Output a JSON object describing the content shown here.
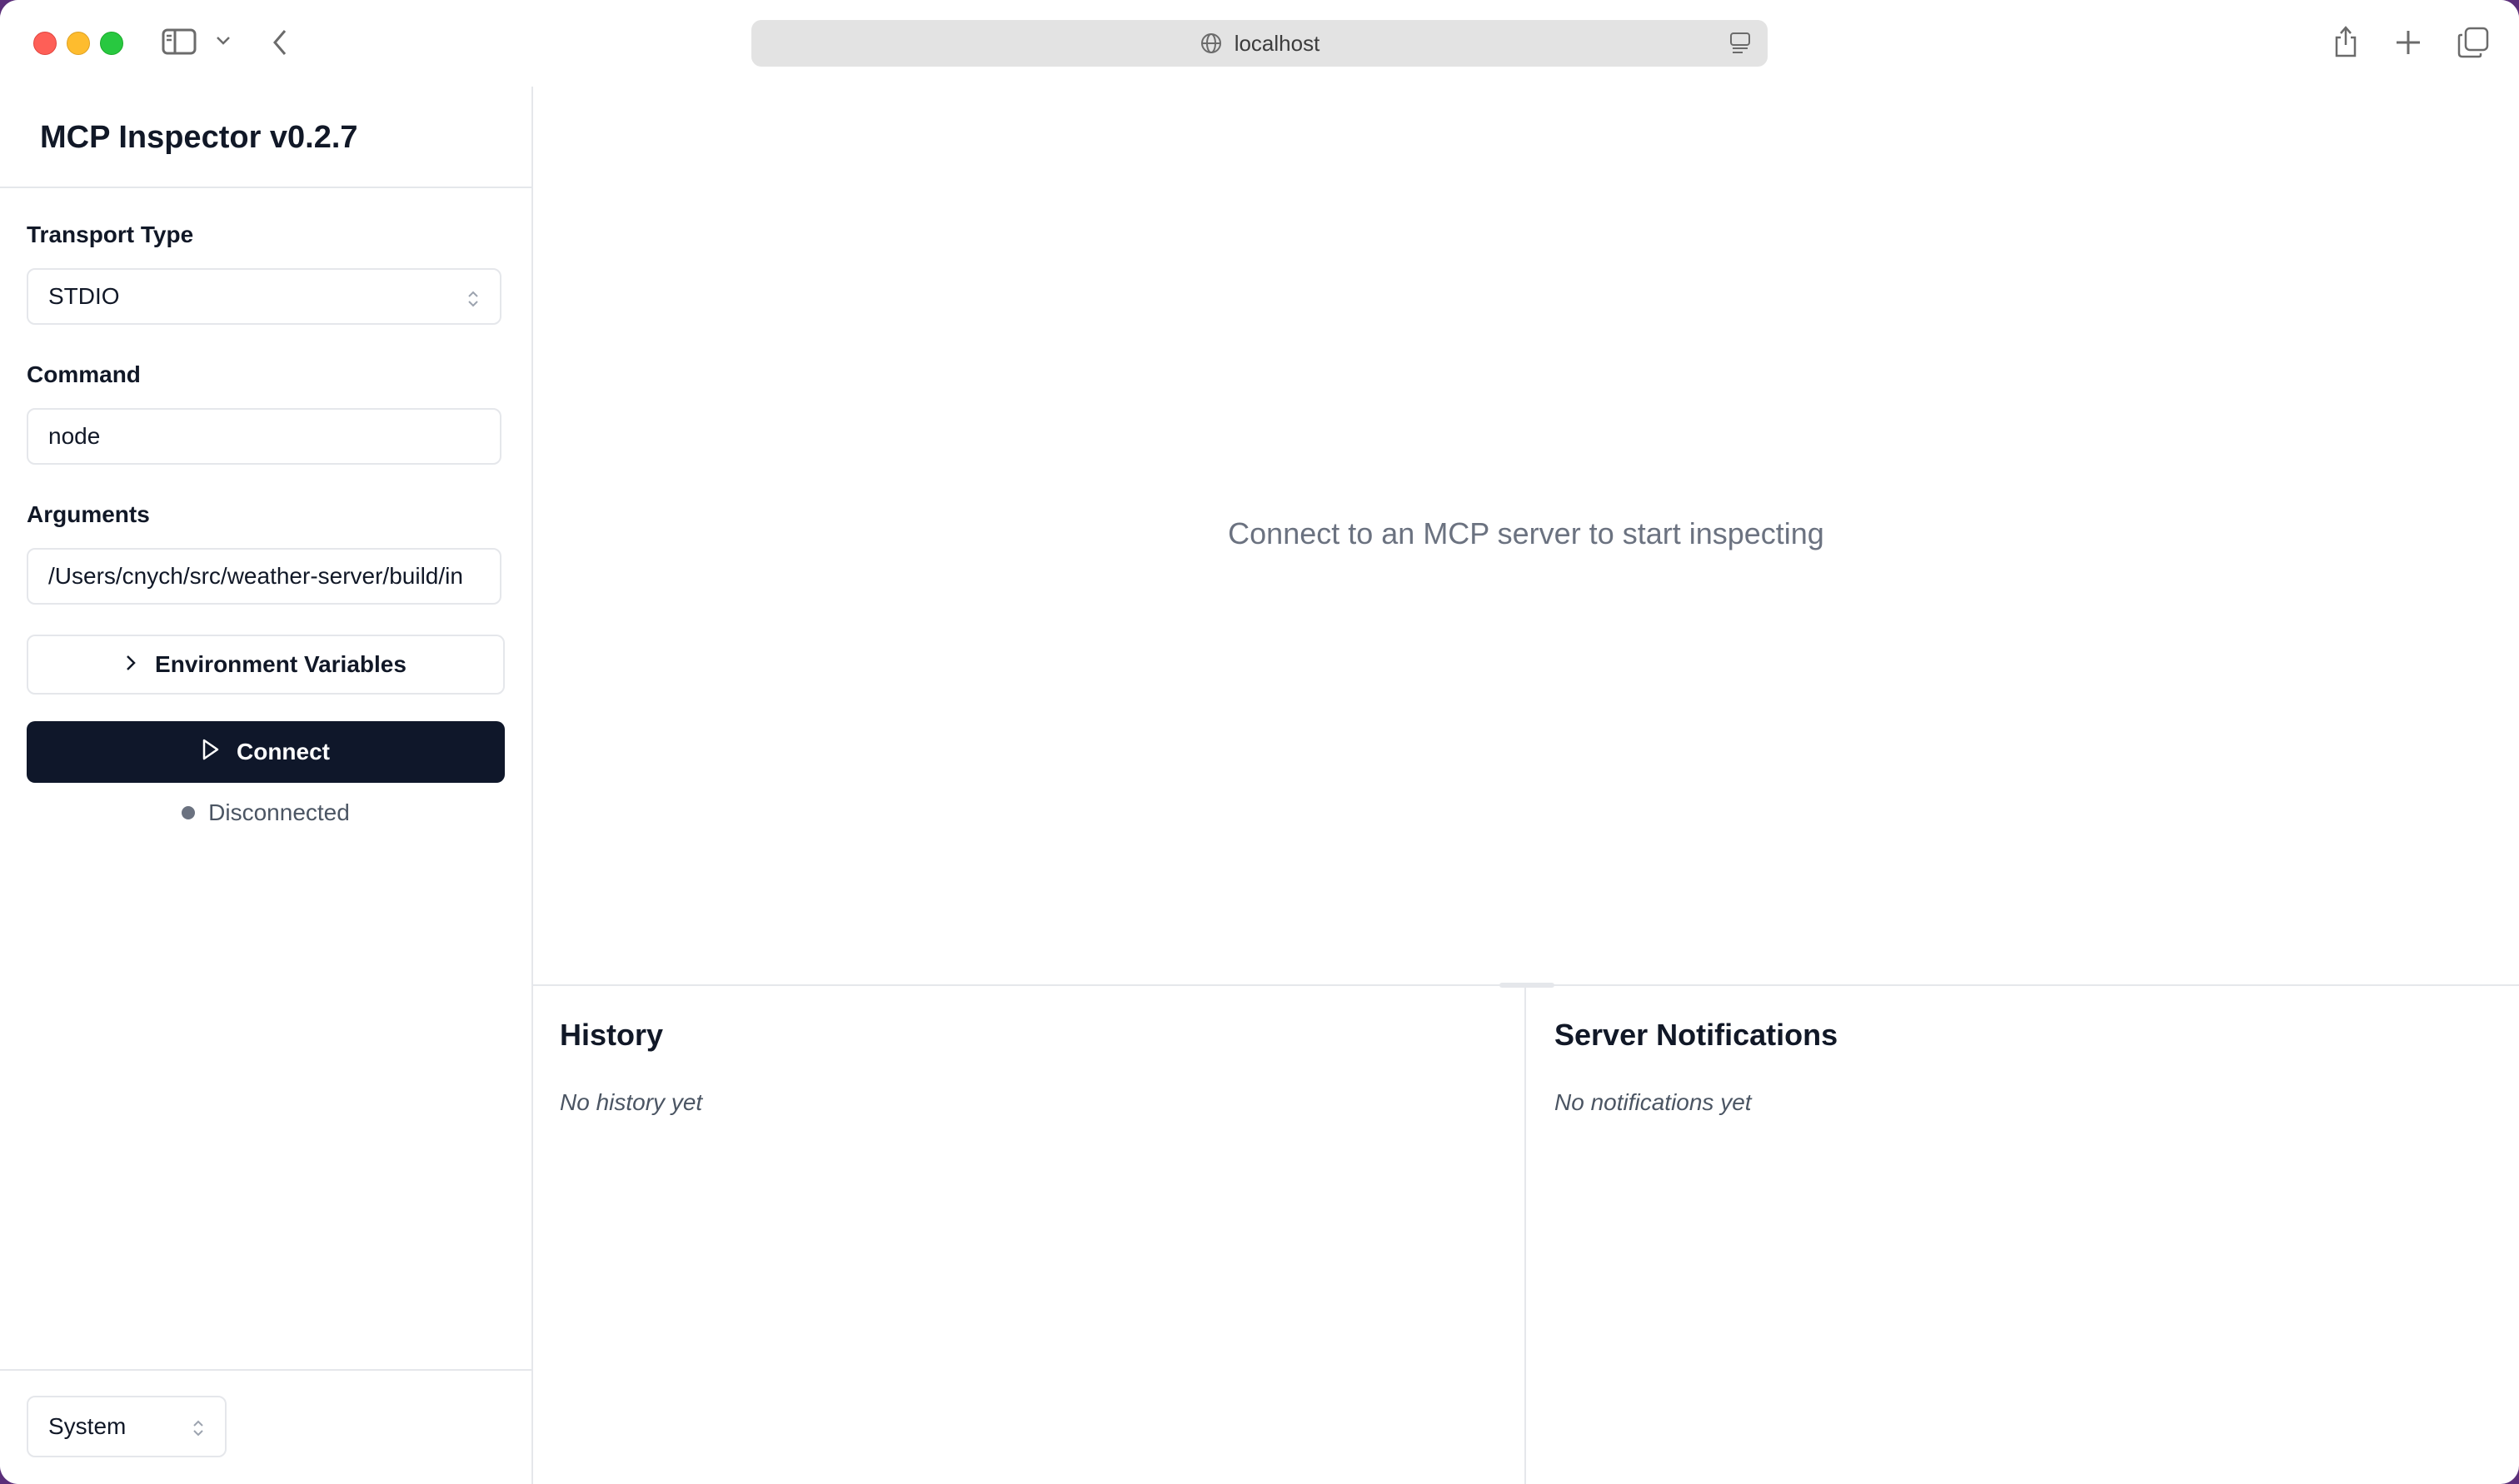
{
  "browser": {
    "url": "localhost"
  },
  "sidebar": {
    "app_title": "MCP Inspector v0.2.7",
    "transport": {
      "label": "Transport Type",
      "value": "STDIO"
    },
    "command": {
      "label": "Command",
      "value": "node"
    },
    "arguments": {
      "label": "Arguments",
      "value": "/Users/cnych/src/weather-server/build/in"
    },
    "env_button_label": "Environment Variables",
    "connect_button_label": "Connect",
    "status_text": "Disconnected",
    "theme_select_value": "System"
  },
  "main": {
    "empty_message": "Connect to an MCP server to start inspecting",
    "history": {
      "title": "History",
      "empty": "No history yet"
    },
    "notifications": {
      "title": "Server Notifications",
      "empty": "No notifications yet"
    }
  },
  "colors": {
    "connect_button_bg": "#0f172a",
    "status_dot": "#6b7280",
    "border": "#e5e7eb"
  }
}
